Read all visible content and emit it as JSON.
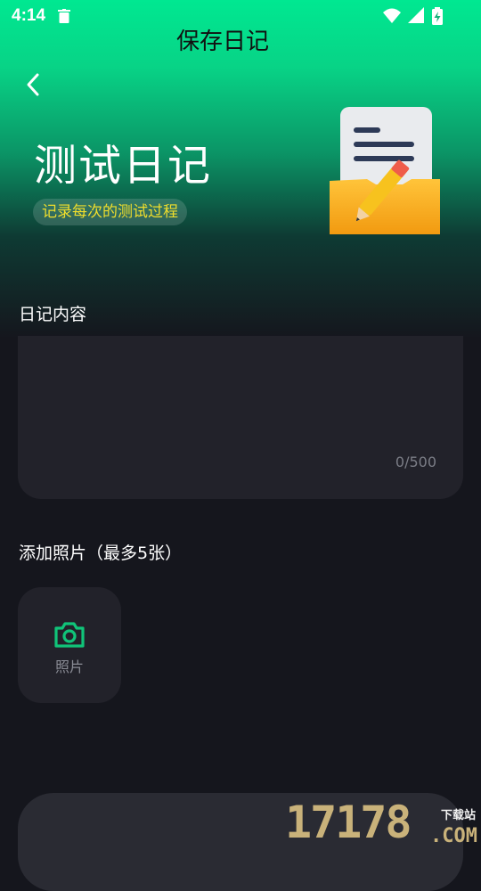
{
  "status_bar": {
    "time": "4:14",
    "icons": [
      "trash-icon",
      "wifi-icon",
      "cell-signal-icon",
      "battery-charging-icon"
    ]
  },
  "header": {
    "title": "测试日记",
    "subtitle": "记录每次的测试过程",
    "subtitle_color": "#f0de2c",
    "gradient_top": "#00e891"
  },
  "content_section": {
    "label": "日记内容",
    "placeholder": "",
    "counter": "0/500"
  },
  "photos_section": {
    "label": "添加照片（最多5张）",
    "add_label": "照片",
    "accent": "#10c479"
  },
  "actions": {
    "save_label": "保存日记"
  },
  "watermark": {
    "number": "17178",
    "suffix": ".COM",
    "tag": "下载站"
  }
}
